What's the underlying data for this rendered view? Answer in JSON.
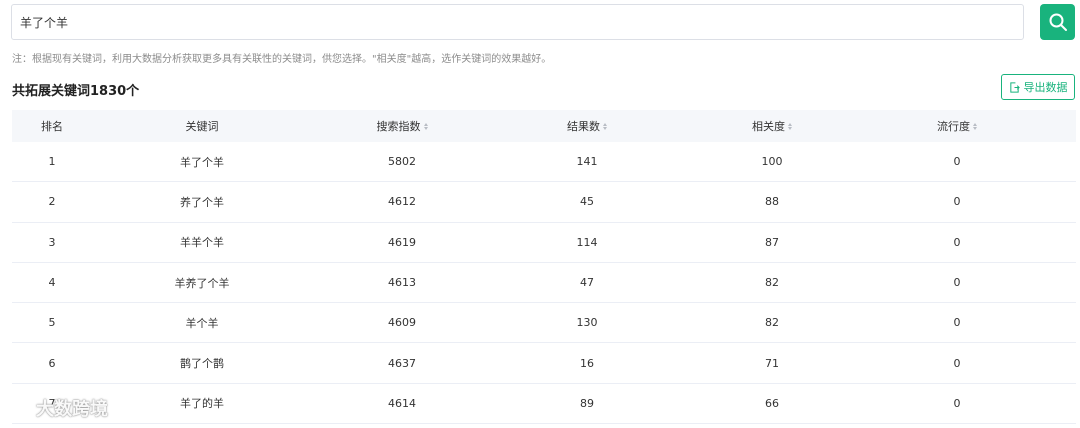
{
  "search": {
    "value": "羊了个羊"
  },
  "note": "注：根据现有关键词，利用大数据分析获取更多具有关联性的关键词，供您选择。\"相关度\"越高，选作关键词的效果越好。",
  "summary": "共拓展关键词1830个",
  "export_label": "导出数据",
  "table": {
    "headers": [
      "排名",
      "关键词",
      "搜索指数",
      "结果数",
      "相关度",
      "流行度"
    ],
    "rows": [
      [
        "1",
        "羊了个羊",
        "5802",
        "141",
        "100",
        "0"
      ],
      [
        "2",
        "养了个羊",
        "4612",
        "45",
        "88",
        "0"
      ],
      [
        "3",
        "羊羊个羊",
        "4619",
        "114",
        "87",
        "0"
      ],
      [
        "4",
        "羊养了个羊",
        "4613",
        "47",
        "82",
        "0"
      ],
      [
        "5",
        "羊个羊",
        "4609",
        "130",
        "82",
        "0"
      ],
      [
        "6",
        "鹊了个鹊",
        "4637",
        "16",
        "71",
        "0"
      ],
      [
        "7",
        "羊了的羊",
        "4614",
        "89",
        "66",
        "0"
      ]
    ]
  },
  "watermark": "大数跨境",
  "colors": {
    "accent": "#19b37d"
  }
}
